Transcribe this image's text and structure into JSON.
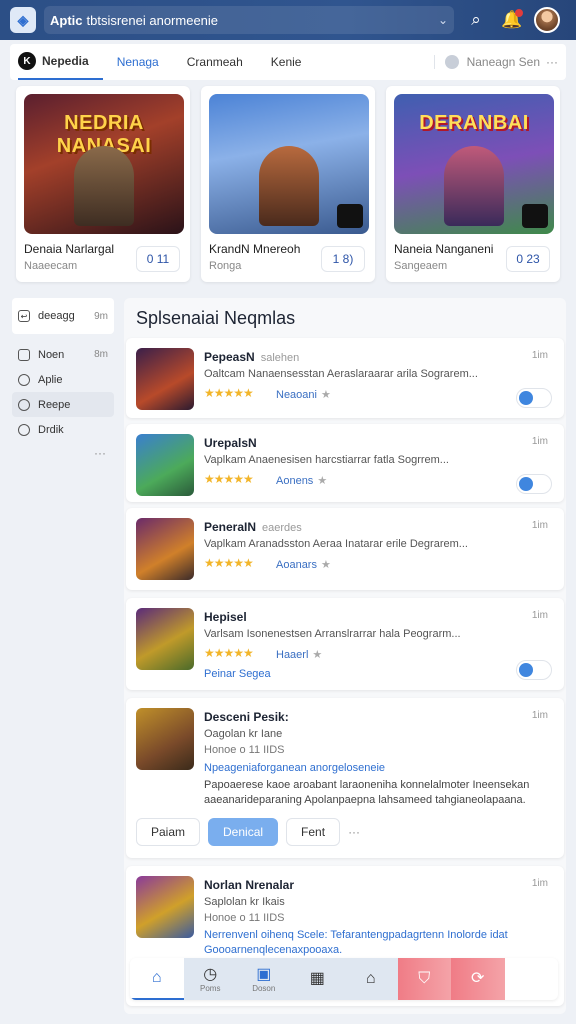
{
  "topbar": {
    "app_name": "Aptic",
    "search_text": "tbtsisrenei anormeenie",
    "notification_badge": true
  },
  "tabs": [
    {
      "label": "Nepedia",
      "active": true
    },
    {
      "label": "Nenaga",
      "active": false
    },
    {
      "label": "Cranmeah",
      "active": false
    },
    {
      "label": "Kenie",
      "active": false
    }
  ],
  "tabs_right": "Naneagn Sen",
  "featured": [
    {
      "art_text": "NEDRIA NANASAI",
      "title": "Denaia Narlargal",
      "sub": "Naaeecam",
      "count": "0 11"
    },
    {
      "art_text": "",
      "title": "KrandN Mnereoh",
      "sub": "Ronga",
      "count": "1 8)"
    },
    {
      "art_text": "DERANBAI",
      "title": "Naneia Nanganeni",
      "sub": "Sangeaem",
      "count": "0 23"
    }
  ],
  "sidebar": {
    "header_label": "deeagg",
    "header_right": "9m",
    "items": [
      {
        "label": "Noen",
        "right": "8m",
        "icon": "square-icon"
      },
      {
        "label": "Aplie",
        "right": "",
        "icon": "circle-icon"
      },
      {
        "label": "Reepe",
        "right": "",
        "icon": "tag-icon",
        "active": true
      },
      {
        "label": "Drdik",
        "right": "",
        "icon": "smile-icon"
      }
    ],
    "more": "···"
  },
  "main": {
    "title": "Splsenaiai Neqmlas",
    "rows": [
      {
        "name": "PepeasN",
        "extra": "salehen",
        "time": "1im",
        "desc": "Oaltcam Nanaensesstan Aeraslaraarar arila Sograrem...",
        "rating_text": "Neaoani",
        "stars": "★★★★★"
      },
      {
        "name": "UrepalsN",
        "extra": "",
        "time": "1im",
        "desc": "Vaplkam Anaenesisen harcstiarrar fatla Sogrrem...",
        "rating_text": "Aonens",
        "stars": "★★★★★"
      },
      {
        "name": "PeneraIN",
        "extra": "eaerdes",
        "time": "1im",
        "desc": "Vaplkam Aranadsston Aeraa Inatarar erile Degrarem...",
        "rating_text": "Aoanars",
        "stars": "★★★★★"
      },
      {
        "name": "Hepisel",
        "extra": "",
        "time": "1im",
        "desc": "Varlsam Isonenestsen Arranslrarrar hala Peograrm...",
        "rating_text": "Haaerl",
        "stars": "★★★★★",
        "link": "Peinar Segea"
      }
    ],
    "detail": {
      "name": "Desceni Pesik:",
      "time": "1im",
      "sub": "Oagolan kr Iane",
      "meta": "Honoe o 11 IIDS",
      "link": "Npeageniaforganean anorgeloseneie",
      "desc": "Papoaerese kaoe aroabant laraoneniha konnelalmoter Ineensekan aaeanarideparaning Apolanpaepna lahsameed tahgianeolapaana.",
      "btn_left": "Paiam",
      "btn_primary": "Denical",
      "btn_right": "Fent",
      "more": "···"
    },
    "last": {
      "name": "Norlan Nrenalar",
      "time": "1im",
      "sub": "Saplolan kr Ikais",
      "meta": "Honoe o 11 IIDS",
      "link": "Nerrenvenl oihenq Scele: Tefarantengpadagrtenn Inolorde idat Goooarnenqlecenaxpooaxa."
    }
  },
  "bottom_nav": [
    {
      "icon": "home-icon",
      "glyph": "⌂",
      "label": "",
      "active": true
    },
    {
      "icon": "clock-icon",
      "glyph": "◷",
      "label": "Poms"
    },
    {
      "icon": "window-icon",
      "glyph": "▣",
      "label": "Doson"
    },
    {
      "icon": "grid-icon",
      "glyph": "▦",
      "label": ""
    },
    {
      "icon": "house-icon",
      "glyph": "⌂",
      "label": ""
    },
    {
      "icon": "shield-icon",
      "glyph": "⛉",
      "label": ""
    },
    {
      "icon": "refresh-icon",
      "glyph": "⟳",
      "label": ""
    }
  ]
}
